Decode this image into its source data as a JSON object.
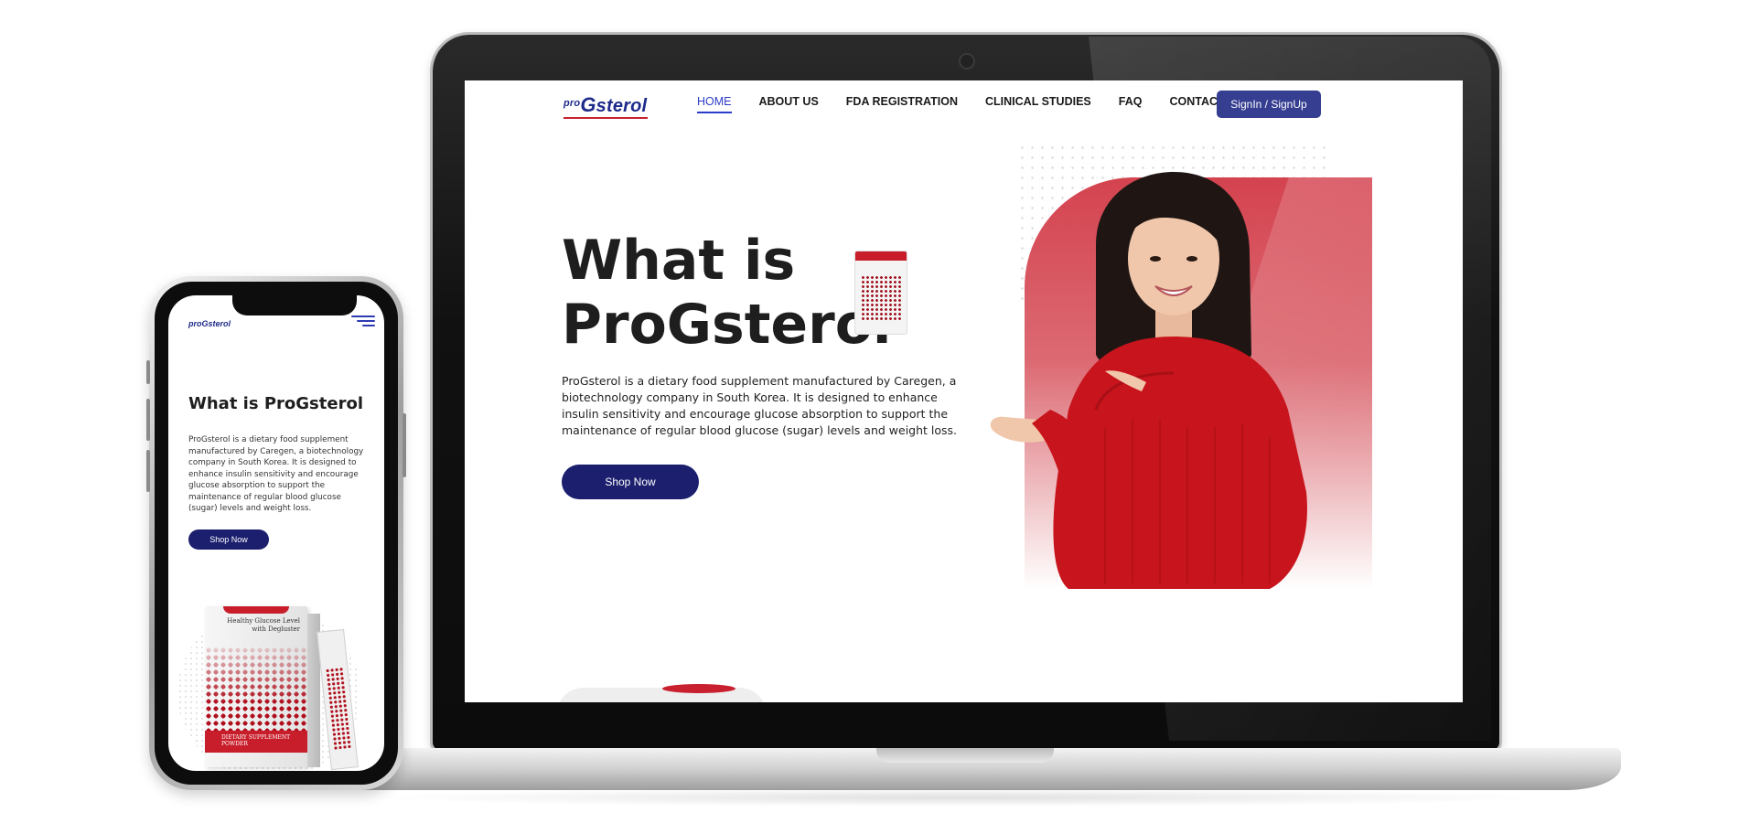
{
  "laptop": {
    "nav": {
      "logo_pro": "pro",
      "logo_g": "G",
      "logo_sterol": "sterol",
      "items": [
        {
          "label": "HOME",
          "active": true
        },
        {
          "label": "ABOUT US",
          "active": false
        },
        {
          "label": "FDA REGISTRATION",
          "active": false
        },
        {
          "label": "CLINICAL STUDIES",
          "active": false
        },
        {
          "label": "FAQ",
          "active": false
        },
        {
          "label": "CONTACT US",
          "active": false
        }
      ],
      "signin_label": "SignIn / SignUp"
    },
    "hero": {
      "title": "What is ProGsterol",
      "description": "ProGsterol is a dietary food supplement manufactured by Caregen, a biotechnology company in South Korea. It is designed to enhance insulin sensitivity and encourage glucose absorption to support the maintenance of regular blood glucose (sugar) levels and weight loss.",
      "shop_label": "Shop Now"
    }
  },
  "phone": {
    "logo": "proGsterol",
    "title": "What is ProGsterol",
    "description": "ProGsterol is a dietary food supplement manufactured by Caregen, a biotechnology company in South Korea. It is designed to enhance insulin sensitivity and encourage glucose absorption to support the maintenance of regular blood glucose (sugar) levels and weight loss.",
    "shop_label": "Shop Now",
    "product": {
      "box_text": "Healthy Glucose Level with Degluster",
      "box_bottom": "DIETARY SUPPLEMENT POWDER"
    }
  },
  "colors": {
    "brand_navy": "#1b1f6e",
    "signin_bg": "#353e91",
    "nav_active": "#2b3cc7",
    "accent_red": "#c8202e",
    "hero_gradient_top": "#d4434f"
  },
  "icons": [
    "hamburger-menu-icon",
    "camera-icon"
  ]
}
